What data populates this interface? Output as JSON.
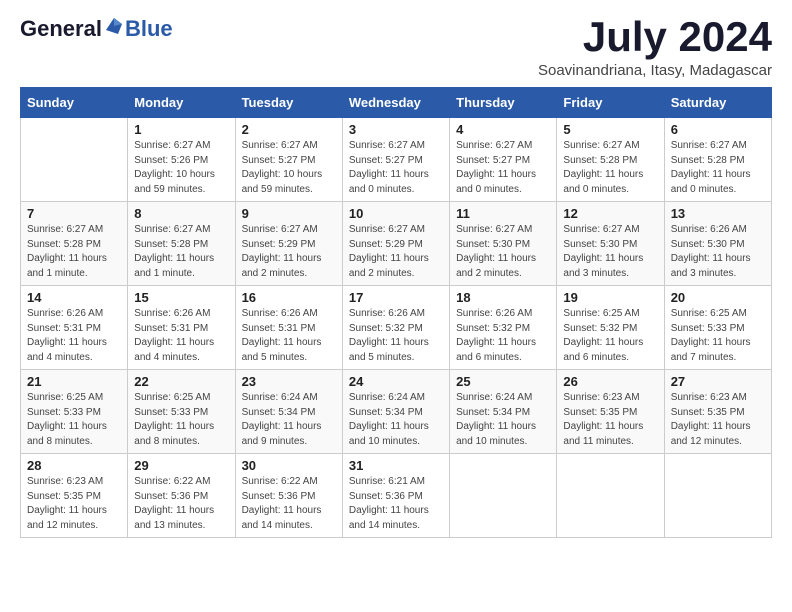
{
  "logo": {
    "general": "General",
    "blue": "Blue"
  },
  "header": {
    "month": "July 2024",
    "location": "Soavinandriana, Itasy, Madagascar"
  },
  "weekdays": [
    "Sunday",
    "Monday",
    "Tuesday",
    "Wednesday",
    "Thursday",
    "Friday",
    "Saturday"
  ],
  "weeks": [
    [
      {
        "day": "",
        "info": ""
      },
      {
        "day": "1",
        "info": "Sunrise: 6:27 AM\nSunset: 5:26 PM\nDaylight: 10 hours\nand 59 minutes."
      },
      {
        "day": "2",
        "info": "Sunrise: 6:27 AM\nSunset: 5:27 PM\nDaylight: 10 hours\nand 59 minutes."
      },
      {
        "day": "3",
        "info": "Sunrise: 6:27 AM\nSunset: 5:27 PM\nDaylight: 11 hours\nand 0 minutes."
      },
      {
        "day": "4",
        "info": "Sunrise: 6:27 AM\nSunset: 5:27 PM\nDaylight: 11 hours\nand 0 minutes."
      },
      {
        "day": "5",
        "info": "Sunrise: 6:27 AM\nSunset: 5:28 PM\nDaylight: 11 hours\nand 0 minutes."
      },
      {
        "day": "6",
        "info": "Sunrise: 6:27 AM\nSunset: 5:28 PM\nDaylight: 11 hours\nand 0 minutes."
      }
    ],
    [
      {
        "day": "7",
        "info": "Sunrise: 6:27 AM\nSunset: 5:28 PM\nDaylight: 11 hours\nand 1 minute."
      },
      {
        "day": "8",
        "info": "Sunrise: 6:27 AM\nSunset: 5:28 PM\nDaylight: 11 hours\nand 1 minute."
      },
      {
        "day": "9",
        "info": "Sunrise: 6:27 AM\nSunset: 5:29 PM\nDaylight: 11 hours\nand 2 minutes."
      },
      {
        "day": "10",
        "info": "Sunrise: 6:27 AM\nSunset: 5:29 PM\nDaylight: 11 hours\nand 2 minutes."
      },
      {
        "day": "11",
        "info": "Sunrise: 6:27 AM\nSunset: 5:30 PM\nDaylight: 11 hours\nand 2 minutes."
      },
      {
        "day": "12",
        "info": "Sunrise: 6:27 AM\nSunset: 5:30 PM\nDaylight: 11 hours\nand 3 minutes."
      },
      {
        "day": "13",
        "info": "Sunrise: 6:26 AM\nSunset: 5:30 PM\nDaylight: 11 hours\nand 3 minutes."
      }
    ],
    [
      {
        "day": "14",
        "info": "Sunrise: 6:26 AM\nSunset: 5:31 PM\nDaylight: 11 hours\nand 4 minutes."
      },
      {
        "day": "15",
        "info": "Sunrise: 6:26 AM\nSunset: 5:31 PM\nDaylight: 11 hours\nand 4 minutes."
      },
      {
        "day": "16",
        "info": "Sunrise: 6:26 AM\nSunset: 5:31 PM\nDaylight: 11 hours\nand 5 minutes."
      },
      {
        "day": "17",
        "info": "Sunrise: 6:26 AM\nSunset: 5:32 PM\nDaylight: 11 hours\nand 5 minutes."
      },
      {
        "day": "18",
        "info": "Sunrise: 6:26 AM\nSunset: 5:32 PM\nDaylight: 11 hours\nand 6 minutes."
      },
      {
        "day": "19",
        "info": "Sunrise: 6:25 AM\nSunset: 5:32 PM\nDaylight: 11 hours\nand 6 minutes."
      },
      {
        "day": "20",
        "info": "Sunrise: 6:25 AM\nSunset: 5:33 PM\nDaylight: 11 hours\nand 7 minutes."
      }
    ],
    [
      {
        "day": "21",
        "info": "Sunrise: 6:25 AM\nSunset: 5:33 PM\nDaylight: 11 hours\nand 8 minutes."
      },
      {
        "day": "22",
        "info": "Sunrise: 6:25 AM\nSunset: 5:33 PM\nDaylight: 11 hours\nand 8 minutes."
      },
      {
        "day": "23",
        "info": "Sunrise: 6:24 AM\nSunset: 5:34 PM\nDaylight: 11 hours\nand 9 minutes."
      },
      {
        "day": "24",
        "info": "Sunrise: 6:24 AM\nSunset: 5:34 PM\nDaylight: 11 hours\nand 10 minutes."
      },
      {
        "day": "25",
        "info": "Sunrise: 6:24 AM\nSunset: 5:34 PM\nDaylight: 11 hours\nand 10 minutes."
      },
      {
        "day": "26",
        "info": "Sunrise: 6:23 AM\nSunset: 5:35 PM\nDaylight: 11 hours\nand 11 minutes."
      },
      {
        "day": "27",
        "info": "Sunrise: 6:23 AM\nSunset: 5:35 PM\nDaylight: 11 hours\nand 12 minutes."
      }
    ],
    [
      {
        "day": "28",
        "info": "Sunrise: 6:23 AM\nSunset: 5:35 PM\nDaylight: 11 hours\nand 12 minutes."
      },
      {
        "day": "29",
        "info": "Sunrise: 6:22 AM\nSunset: 5:36 PM\nDaylight: 11 hours\nand 13 minutes."
      },
      {
        "day": "30",
        "info": "Sunrise: 6:22 AM\nSunset: 5:36 PM\nDaylight: 11 hours\nand 14 minutes."
      },
      {
        "day": "31",
        "info": "Sunrise: 6:21 AM\nSunset: 5:36 PM\nDaylight: 11 hours\nand 14 minutes."
      },
      {
        "day": "",
        "info": ""
      },
      {
        "day": "",
        "info": ""
      },
      {
        "day": "",
        "info": ""
      }
    ]
  ]
}
